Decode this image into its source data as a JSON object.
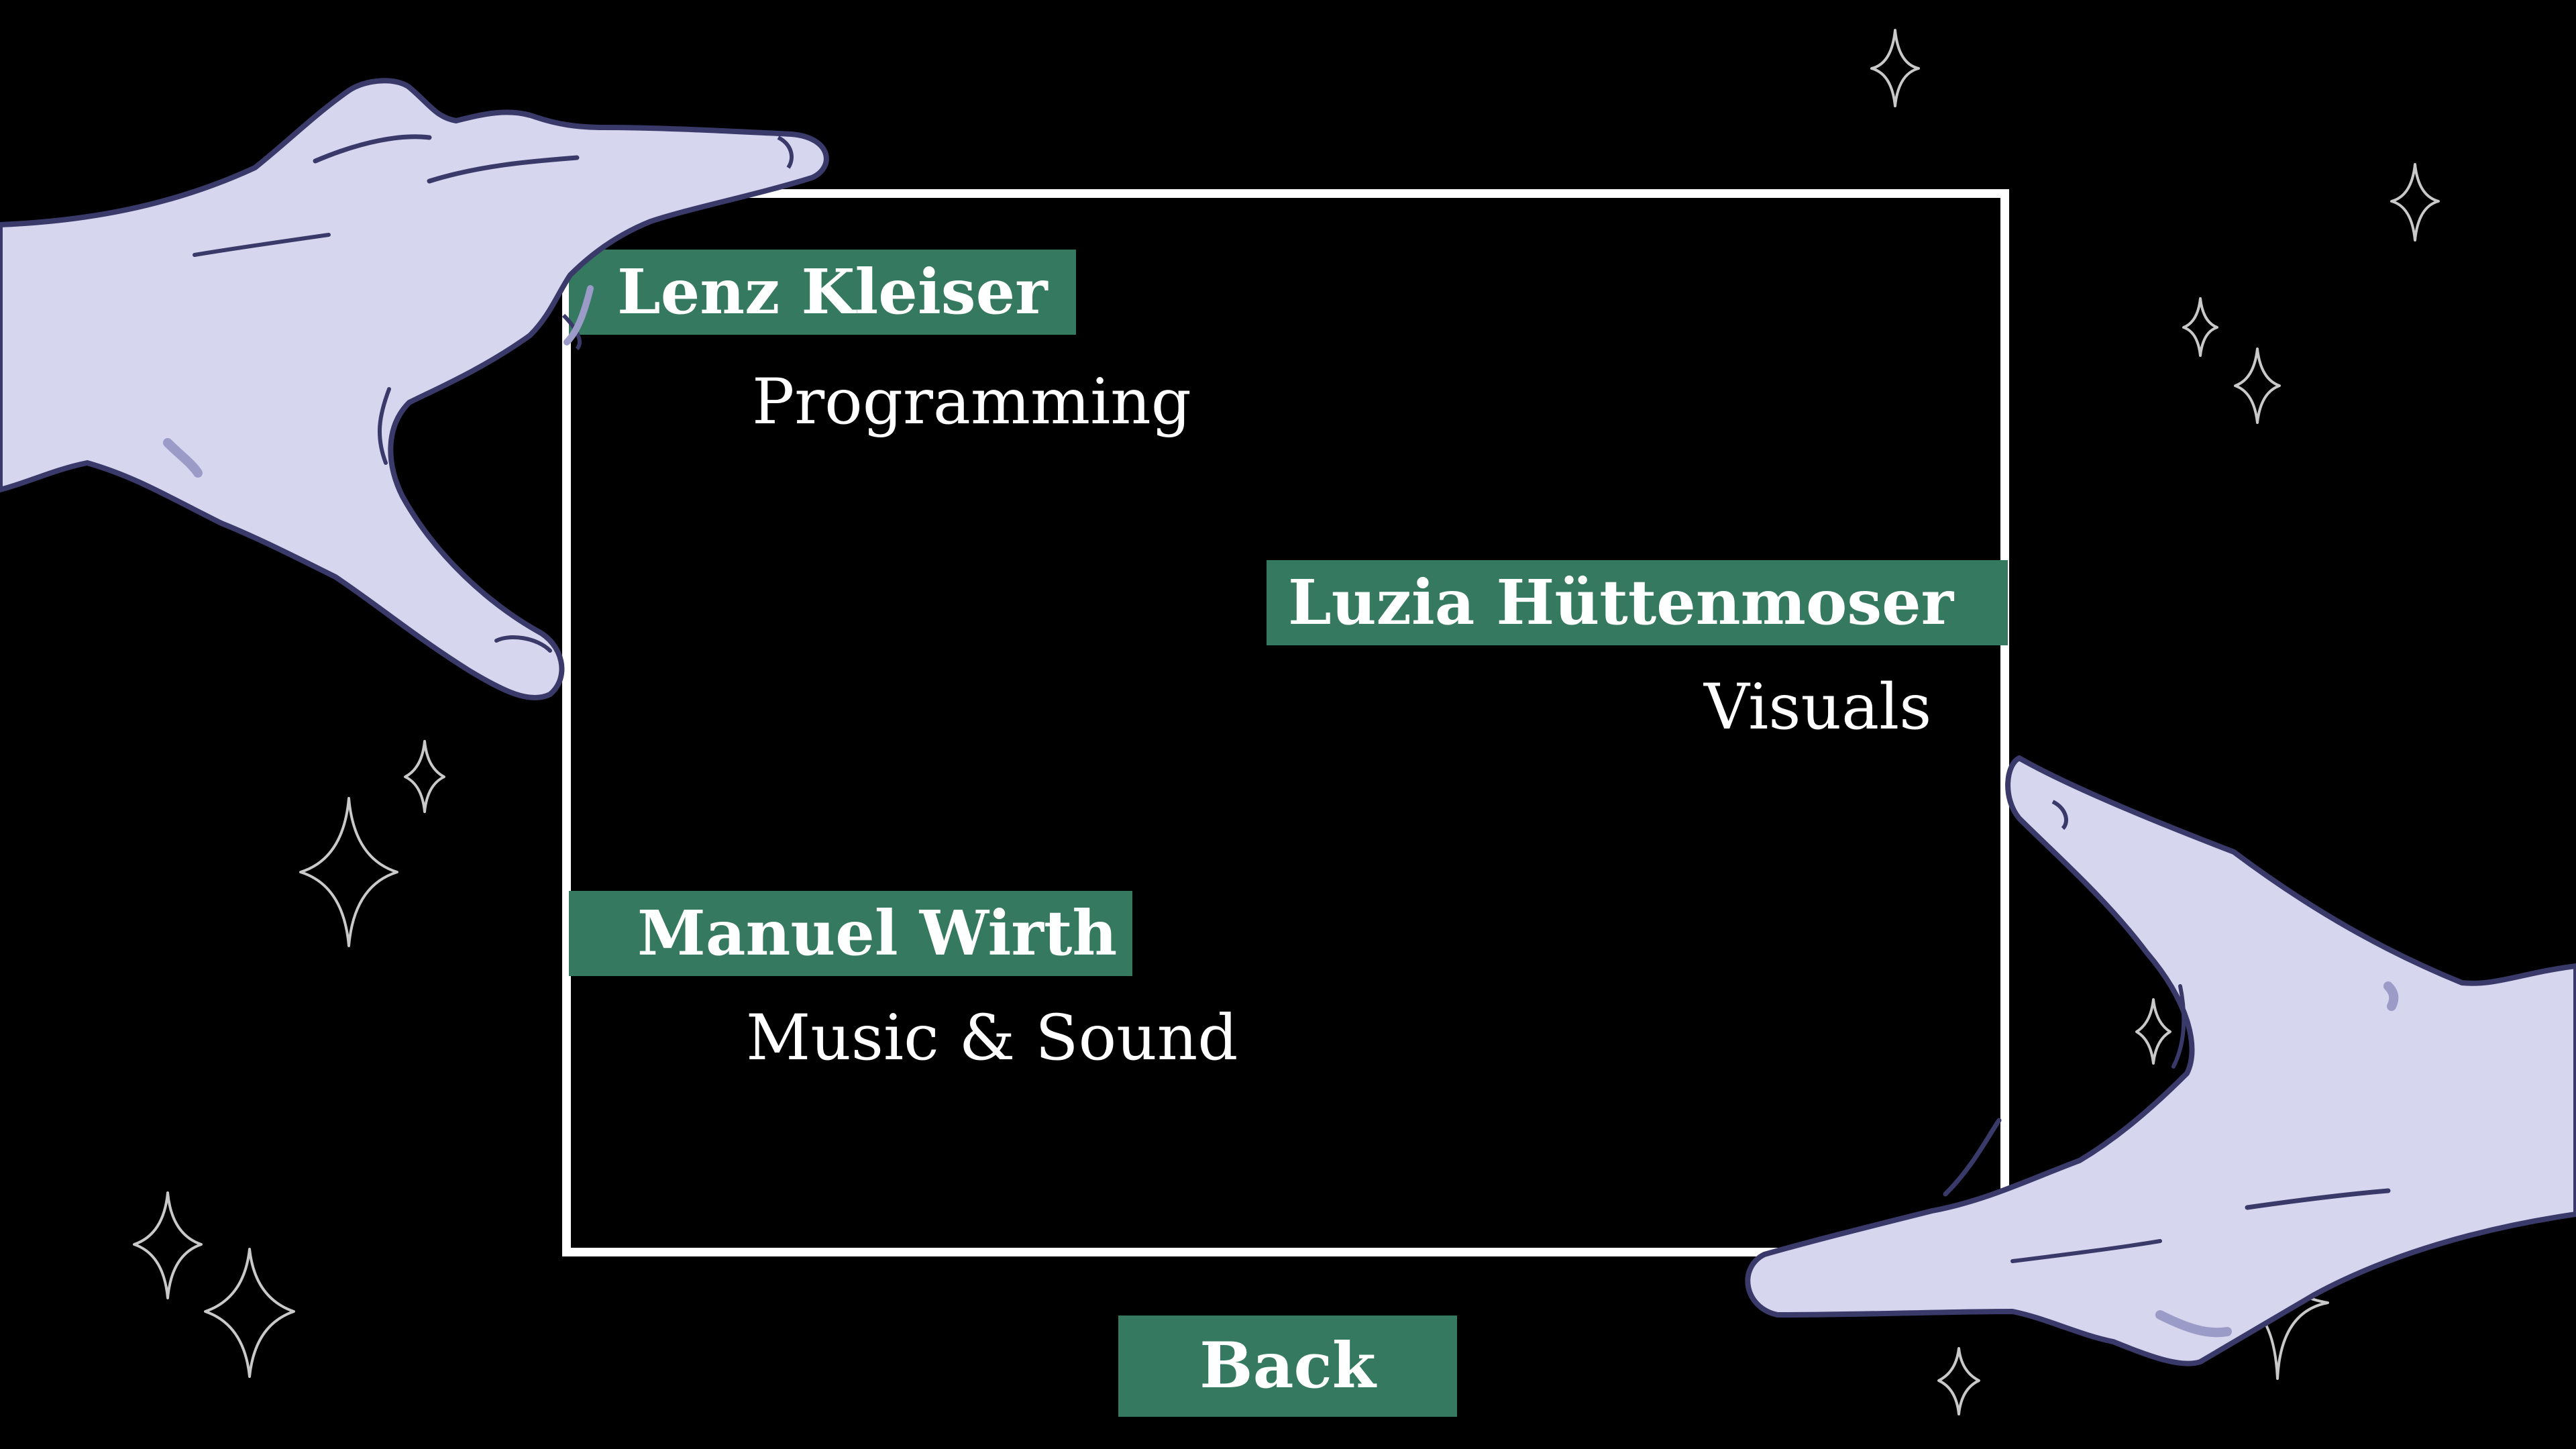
{
  "screen": "credits",
  "credits": [
    {
      "name": "Lenz Kleiser",
      "role": "Programming"
    },
    {
      "name": "Luzia Hüttenmoser",
      "role": "Visuals"
    },
    {
      "name": "Manuel Wirth",
      "role": "Music & Sound"
    }
  ],
  "back_button": {
    "label": "Back"
  },
  "colors": {
    "background": "#000000",
    "accent_green": "#357a60",
    "frame": "#ffffff",
    "hand_fill": "#d6d6ee",
    "hand_outline": "#3a3a6a",
    "sparkle": "#c9c9c9"
  },
  "icons": [
    "left-hand-icon",
    "right-hand-icon",
    "sparkle-icon"
  ]
}
